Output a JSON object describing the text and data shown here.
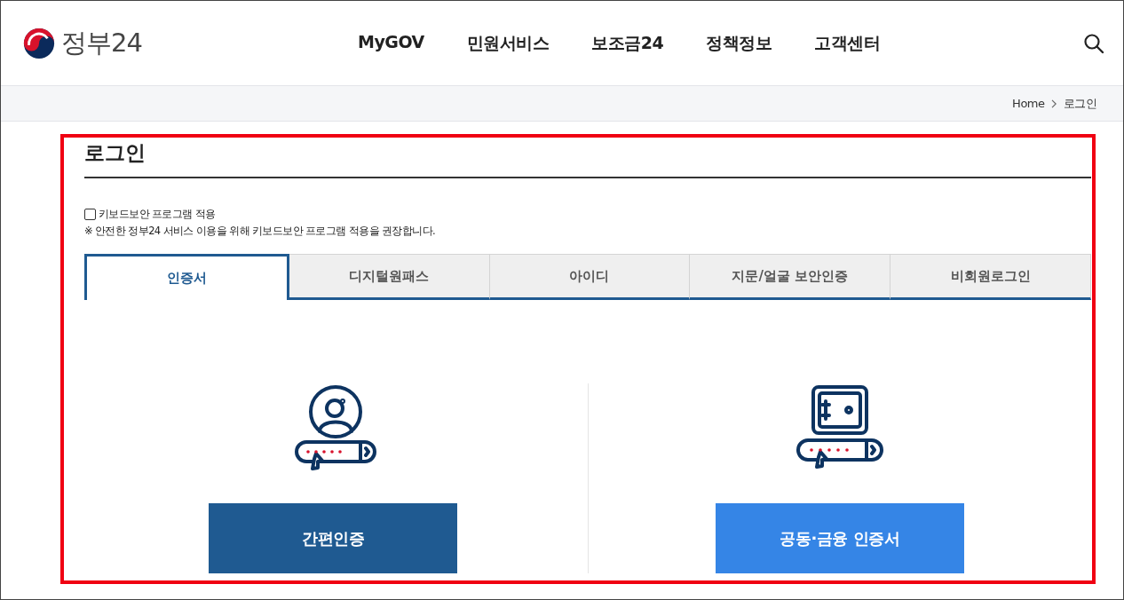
{
  "header": {
    "logo_text": "정부24",
    "nav": [
      "MyGOV",
      "민원서비스",
      "보조금24",
      "정책정보",
      "고객센터"
    ]
  },
  "breadcrumb": [
    "Home",
    "로그인"
  ],
  "page_title": "로그인",
  "keyboard_security": {
    "label": "키보드보안 프로그램 적용",
    "checked": false
  },
  "notice": "※ 안전한 정부24 서비스 이용을 위해 키보드보안 프로그램 적용을 권장합니다.",
  "tabs": [
    {
      "label": "인증서",
      "selected": true
    },
    {
      "label": "디지털원패스",
      "selected": false
    },
    {
      "label": "아이디",
      "selected": false
    },
    {
      "label": "지문/얼굴 보안인증",
      "selected": false
    },
    {
      "label": "비회원로그인",
      "selected": false
    }
  ],
  "options": [
    {
      "kind": "simple",
      "button": "간편인증"
    },
    {
      "kind": "certificate",
      "button": "공동·금융 인증서"
    }
  ]
}
